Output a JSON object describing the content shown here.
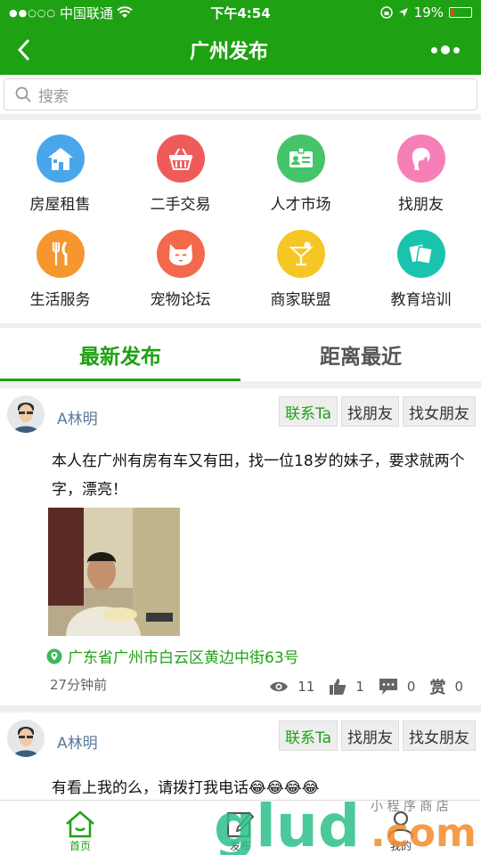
{
  "status_bar": {
    "carrier": "中国联通",
    "time": "下午4:54",
    "battery": "19%"
  },
  "nav": {
    "title": "广州发布"
  },
  "search": {
    "placeholder": "搜索"
  },
  "categories": [
    {
      "label": "房屋租售",
      "icon": "house-icon",
      "color": "#4aa6ea"
    },
    {
      "label": "二手交易",
      "icon": "basket-icon",
      "color": "#ef5b5b"
    },
    {
      "label": "人才市场",
      "icon": "id-card-icon",
      "color": "#45c46a"
    },
    {
      "label": "找朋友",
      "icon": "girl-icon",
      "color": "#f77fb7"
    },
    {
      "label": "生活服务",
      "icon": "fork-knife-icon",
      "color": "#f7962f"
    },
    {
      "label": "宠物论坛",
      "icon": "cat-icon",
      "color": "#f2694b"
    },
    {
      "label": "商家联盟",
      "icon": "cocktail-icon",
      "color": "#f6c624"
    },
    {
      "label": "教育培训",
      "icon": "cards-icon",
      "color": "#19c3ad"
    }
  ],
  "tabs": [
    {
      "label": "最新发布"
    },
    {
      "label": "距离最近"
    }
  ],
  "posts": [
    {
      "user": "A林明",
      "tags": [
        "联系Ta",
        "找朋友",
        "找女朋友"
      ],
      "content": "本人在广州有房有车又有田，找一位18岁的妹子，要求就两个字，漂亮！",
      "address": "广东省广州市白云区黄边中街63号",
      "time": "27分钟前",
      "views": "11",
      "likes": "1",
      "comments": "0",
      "reward_label": "赏",
      "rewards": "0"
    },
    {
      "user": "A林明",
      "tags": [
        "联系Ta",
        "找朋友",
        "找女朋友"
      ],
      "content": "有看上我的么，请拨打我电话😂😂😂😂"
    }
  ],
  "bottom_tabs": [
    {
      "label": "首页"
    },
    {
      "label": "发布"
    },
    {
      "label": "我的"
    }
  ],
  "watermark": {
    "text": "glud.com",
    "sub": "小 程 序 商 店"
  },
  "colors": {
    "brand": "#1fa114"
  }
}
